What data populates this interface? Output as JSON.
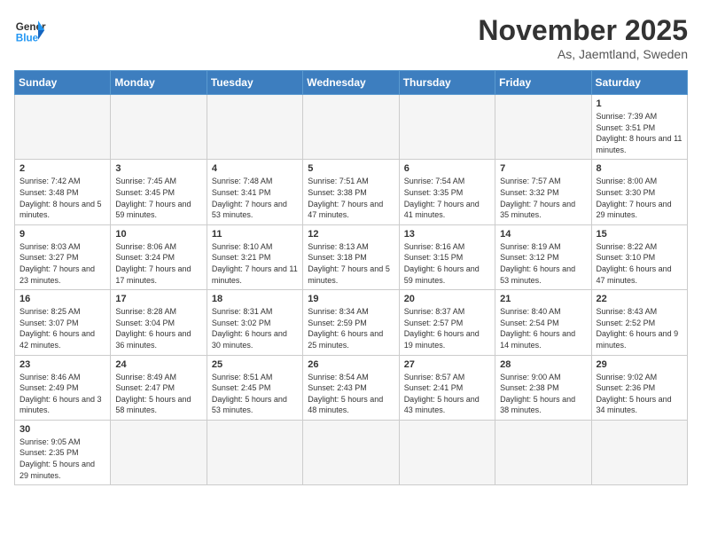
{
  "logo": {
    "text_general": "General",
    "text_blue": "Blue"
  },
  "header": {
    "month": "November 2025",
    "location": "As, Jaemtland, Sweden"
  },
  "weekdays": [
    "Sunday",
    "Monday",
    "Tuesday",
    "Wednesday",
    "Thursday",
    "Friday",
    "Saturday"
  ],
  "weeks": [
    [
      {
        "day": "",
        "info": ""
      },
      {
        "day": "",
        "info": ""
      },
      {
        "day": "",
        "info": ""
      },
      {
        "day": "",
        "info": ""
      },
      {
        "day": "",
        "info": ""
      },
      {
        "day": "",
        "info": ""
      },
      {
        "day": "1",
        "info": "Sunrise: 7:39 AM\nSunset: 3:51 PM\nDaylight: 8 hours\nand 11 minutes."
      }
    ],
    [
      {
        "day": "2",
        "info": "Sunrise: 7:42 AM\nSunset: 3:48 PM\nDaylight: 8 hours\nand 5 minutes."
      },
      {
        "day": "3",
        "info": "Sunrise: 7:45 AM\nSunset: 3:45 PM\nDaylight: 7 hours\nand 59 minutes."
      },
      {
        "day": "4",
        "info": "Sunrise: 7:48 AM\nSunset: 3:41 PM\nDaylight: 7 hours\nand 53 minutes."
      },
      {
        "day": "5",
        "info": "Sunrise: 7:51 AM\nSunset: 3:38 PM\nDaylight: 7 hours\nand 47 minutes."
      },
      {
        "day": "6",
        "info": "Sunrise: 7:54 AM\nSunset: 3:35 PM\nDaylight: 7 hours\nand 41 minutes."
      },
      {
        "day": "7",
        "info": "Sunrise: 7:57 AM\nSunset: 3:32 PM\nDaylight: 7 hours\nand 35 minutes."
      },
      {
        "day": "8",
        "info": "Sunrise: 8:00 AM\nSunset: 3:30 PM\nDaylight: 7 hours\nand 29 minutes."
      }
    ],
    [
      {
        "day": "9",
        "info": "Sunrise: 8:03 AM\nSunset: 3:27 PM\nDaylight: 7 hours\nand 23 minutes."
      },
      {
        "day": "10",
        "info": "Sunrise: 8:06 AM\nSunset: 3:24 PM\nDaylight: 7 hours\nand 17 minutes."
      },
      {
        "day": "11",
        "info": "Sunrise: 8:10 AM\nSunset: 3:21 PM\nDaylight: 7 hours\nand 11 minutes."
      },
      {
        "day": "12",
        "info": "Sunrise: 8:13 AM\nSunset: 3:18 PM\nDaylight: 7 hours\nand 5 minutes."
      },
      {
        "day": "13",
        "info": "Sunrise: 8:16 AM\nSunset: 3:15 PM\nDaylight: 6 hours\nand 59 minutes."
      },
      {
        "day": "14",
        "info": "Sunrise: 8:19 AM\nSunset: 3:12 PM\nDaylight: 6 hours\nand 53 minutes."
      },
      {
        "day": "15",
        "info": "Sunrise: 8:22 AM\nSunset: 3:10 PM\nDaylight: 6 hours\nand 47 minutes."
      }
    ],
    [
      {
        "day": "16",
        "info": "Sunrise: 8:25 AM\nSunset: 3:07 PM\nDaylight: 6 hours\nand 42 minutes."
      },
      {
        "day": "17",
        "info": "Sunrise: 8:28 AM\nSunset: 3:04 PM\nDaylight: 6 hours\nand 36 minutes."
      },
      {
        "day": "18",
        "info": "Sunrise: 8:31 AM\nSunset: 3:02 PM\nDaylight: 6 hours\nand 30 minutes."
      },
      {
        "day": "19",
        "info": "Sunrise: 8:34 AM\nSunset: 2:59 PM\nDaylight: 6 hours\nand 25 minutes."
      },
      {
        "day": "20",
        "info": "Sunrise: 8:37 AM\nSunset: 2:57 PM\nDaylight: 6 hours\nand 19 minutes."
      },
      {
        "day": "21",
        "info": "Sunrise: 8:40 AM\nSunset: 2:54 PM\nDaylight: 6 hours\nand 14 minutes."
      },
      {
        "day": "22",
        "info": "Sunrise: 8:43 AM\nSunset: 2:52 PM\nDaylight: 6 hours\nand 9 minutes."
      }
    ],
    [
      {
        "day": "23",
        "info": "Sunrise: 8:46 AM\nSunset: 2:49 PM\nDaylight: 6 hours\nand 3 minutes."
      },
      {
        "day": "24",
        "info": "Sunrise: 8:49 AM\nSunset: 2:47 PM\nDaylight: 5 hours\nand 58 minutes."
      },
      {
        "day": "25",
        "info": "Sunrise: 8:51 AM\nSunset: 2:45 PM\nDaylight: 5 hours\nand 53 minutes."
      },
      {
        "day": "26",
        "info": "Sunrise: 8:54 AM\nSunset: 2:43 PM\nDaylight: 5 hours\nand 48 minutes."
      },
      {
        "day": "27",
        "info": "Sunrise: 8:57 AM\nSunset: 2:41 PM\nDaylight: 5 hours\nand 43 minutes."
      },
      {
        "day": "28",
        "info": "Sunrise: 9:00 AM\nSunset: 2:38 PM\nDaylight: 5 hours\nand 38 minutes."
      },
      {
        "day": "29",
        "info": "Sunrise: 9:02 AM\nSunset: 2:36 PM\nDaylight: 5 hours\nand 34 minutes."
      }
    ],
    [
      {
        "day": "30",
        "info": "Sunrise: 9:05 AM\nSunset: 2:35 PM\nDaylight: 5 hours\nand 29 minutes."
      },
      {
        "day": "",
        "info": ""
      },
      {
        "day": "",
        "info": ""
      },
      {
        "day": "",
        "info": ""
      },
      {
        "day": "",
        "info": ""
      },
      {
        "day": "",
        "info": ""
      },
      {
        "day": "",
        "info": ""
      }
    ]
  ]
}
